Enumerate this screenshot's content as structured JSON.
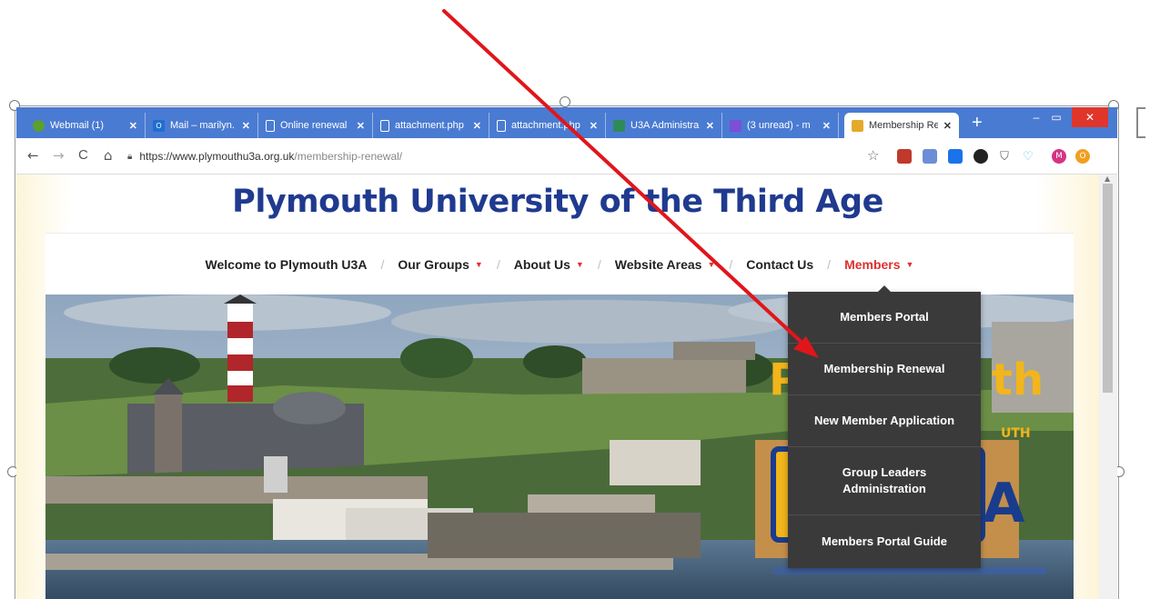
{
  "browser": {
    "tabs": [
      {
        "label": "Webmail (1)",
        "icon": "webmail-icon",
        "color": "#5aa02c"
      },
      {
        "label": "Mail – marilyn.",
        "icon": "outlook-icon",
        "color": "#1e6fd1"
      },
      {
        "label": "Online renewal",
        "icon": "document-icon",
        "color": "#ffffff"
      },
      {
        "label": "attachment.php",
        "icon": "document-icon",
        "color": "#ffffff"
      },
      {
        "label": "attachment.php",
        "icon": "document-icon",
        "color": "#ffffff"
      },
      {
        "label": "U3A Administra",
        "icon": "u3a-admin-icon",
        "color": "#2e8b57"
      },
      {
        "label": "(3 unread) - m",
        "icon": "yahoo-mail-icon",
        "color": "#7b4fd6"
      },
      {
        "label": "Membership Re",
        "icon": "u3a-site-icon",
        "color": "#e5a92a"
      }
    ],
    "new_tab": "+",
    "window_controls": {
      "minimize": "‒",
      "maximize": "▭",
      "close": "✕"
    },
    "url": {
      "domain": "https://www.plymouthu3a.org.uk",
      "path": "/membership-renewal/"
    },
    "nav": {
      "back": "←",
      "forward": "→",
      "reload": "C",
      "home": "⌂"
    },
    "extensions": [
      {
        "name": "red-extension-icon",
        "color": "#c0392b"
      },
      {
        "name": "slides-extension-icon",
        "color": "#6b8fd6"
      },
      {
        "name": "search-extension-icon",
        "color": "#1a73e8"
      },
      {
        "name": "bird-extension-icon",
        "color": "#222222"
      },
      {
        "name": "shield-extension-icon",
        "color": "#555555"
      },
      {
        "name": "maps-extension-icon",
        "color": "#5cc2e0"
      },
      {
        "name": "avatar-icon",
        "color": "#d63384",
        "letter": "M"
      },
      {
        "name": "coin-extension-icon",
        "color": "#f0a020",
        "letter": "O"
      }
    ]
  },
  "site": {
    "title": "Plymouth University of the Third Age",
    "nav": [
      {
        "label": "Welcome to Plymouth U3A",
        "dropdown": false
      },
      {
        "label": "Our Groups",
        "dropdown": true
      },
      {
        "label": "About Us",
        "dropdown": true
      },
      {
        "label": "Website Areas",
        "dropdown": true
      },
      {
        "label": "Contact Us",
        "dropdown": false
      },
      {
        "label": "Members",
        "dropdown": true,
        "active": true
      }
    ],
    "nav_separator": "/",
    "members_menu": [
      "Members Portal",
      "Membership Renewal",
      "New Member Application",
      "Group Leaders Administration",
      "Members Portal Guide"
    ]
  },
  "colors": {
    "accent": "#e03030",
    "title": "#1f3a8f",
    "tab_strip": "#4a7bd2",
    "menu_bg": "#3a3a3a",
    "annotation_arrow": "#e0161b"
  }
}
